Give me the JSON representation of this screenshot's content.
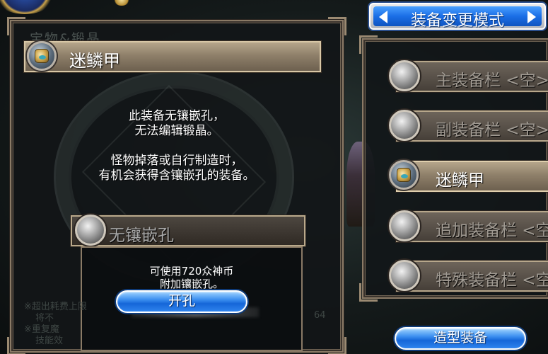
{
  "background": {
    "left_panel_ghost_title": "宝物&锻晶",
    "ghost_notes": [
      "※超出耗费上限",
      "将不",
      "※重复魔",
      "技能效",
      "64"
    ]
  },
  "left_panel": {
    "item_name": "迷鳞甲",
    "item_icon": "armor-gem-icon",
    "message_line1": "此装备无镶嵌孔，",
    "message_line2": "无法编辑锻晶。",
    "message_line3": "怪物掉落或自行制造时，",
    "message_line4": "有机会获得含镶嵌孔的装备。",
    "socket_label": "无镶嵌孔",
    "cost_line1": "可使用720众神币",
    "cost_line2": "附加镶嵌孔。",
    "open_button": "开孔"
  },
  "right_panel": {
    "mode_title": "装备变更模式",
    "slots": [
      {
        "label": "主装备栏 <空>",
        "icon": "empty-slot-icon",
        "active": false
      },
      {
        "label": "副装备栏 <空>",
        "icon": "empty-slot-icon",
        "active": false
      },
      {
        "label": "迷鳞甲",
        "icon": "armor-gem-icon",
        "active": true
      },
      {
        "label": "追加装备栏 <空>",
        "icon": "empty-slot-icon",
        "active": false
      },
      {
        "label": "特殊装备栏 <空>",
        "icon": "empty-slot-icon",
        "active": false
      }
    ],
    "style_button": "造型装备"
  },
  "colors": {
    "button_blue": "#1566d8",
    "panel_border": "#8a7a66",
    "inactive_text": "#a09a92"
  }
}
